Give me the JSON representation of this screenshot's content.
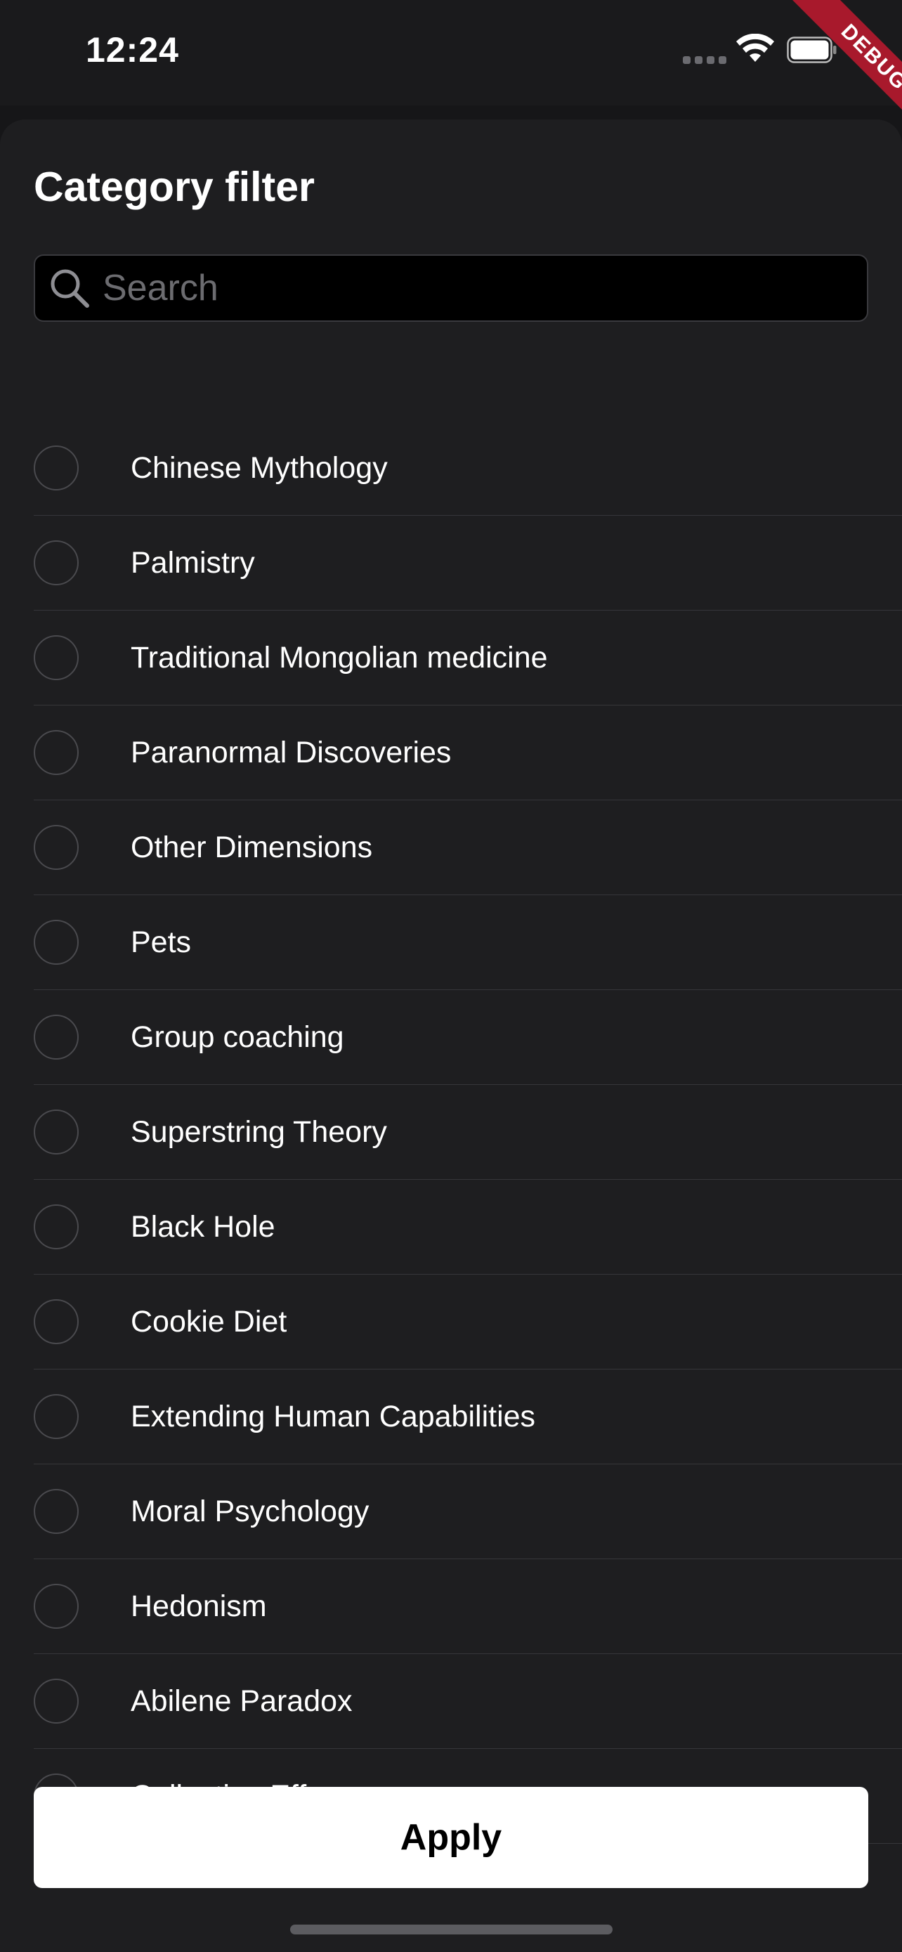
{
  "status_bar": {
    "time": "12:24"
  },
  "debug_banner": {
    "label": "DEBUG"
  },
  "sheet": {
    "title": "Category filter",
    "search": {
      "placeholder": "Search",
      "value": ""
    },
    "categories": [
      {
        "label": "Chinese Mythology",
        "selected": false
      },
      {
        "label": "Palmistry",
        "selected": false
      },
      {
        "label": "Traditional Mongolian medicine",
        "selected": false
      },
      {
        "label": "Paranormal Discoveries",
        "selected": false
      },
      {
        "label": "Other Dimensions",
        "selected": false
      },
      {
        "label": "Pets",
        "selected": false
      },
      {
        "label": "Group coaching",
        "selected": false
      },
      {
        "label": "Superstring Theory",
        "selected": false
      },
      {
        "label": "Black Hole",
        "selected": false
      },
      {
        "label": "Cookie Diet",
        "selected": false
      },
      {
        "label": "Extending Human Capabilities",
        "selected": false
      },
      {
        "label": "Moral Psychology",
        "selected": false
      },
      {
        "label": "Hedonism",
        "selected": false
      },
      {
        "label": "Abilene Paradox",
        "selected": false
      },
      {
        "label": "Collective Effervescence",
        "selected": false
      }
    ],
    "apply_label": "Apply"
  },
  "icons": {
    "search": "search-icon",
    "wifi": "wifi-icon",
    "battery": "battery-icon",
    "radio": "radio-circle-icon"
  },
  "colors": {
    "background": "#1e1e20",
    "search_background": "#000000",
    "text": "#ffffff",
    "placeholder": "#6c6c70",
    "divider": "#36363a",
    "radio_border": "#4a4a4e",
    "button_background": "#ffffff",
    "button_text": "#000000",
    "debug_ribbon": "#a8192c"
  }
}
